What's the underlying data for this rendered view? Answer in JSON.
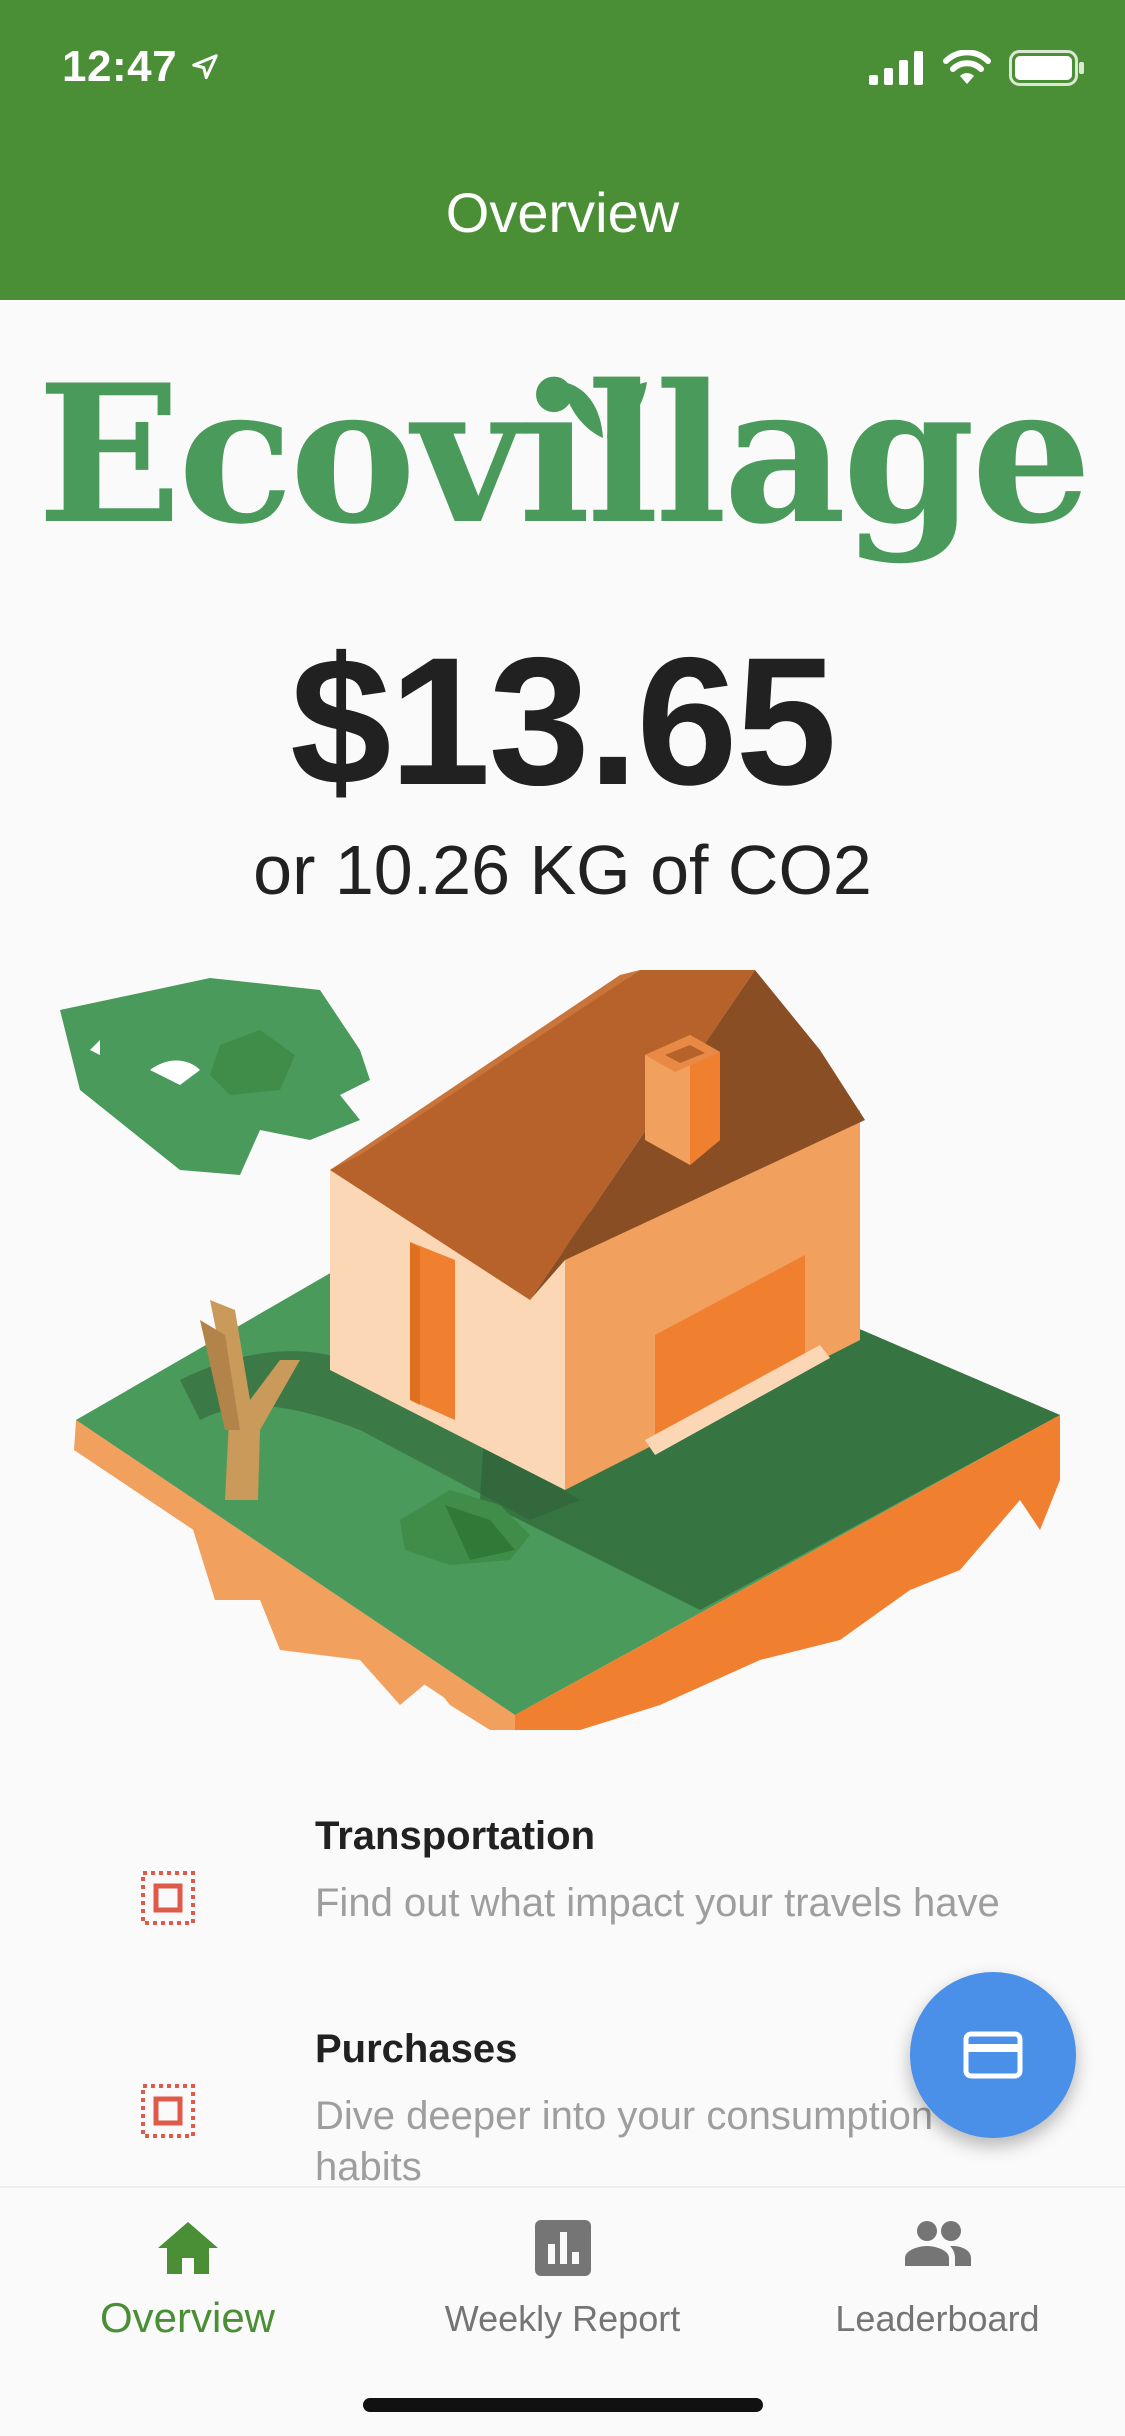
{
  "status_bar": {
    "time": "12:47",
    "icons": [
      "location-arrow-icon",
      "cellular-signal-icon",
      "wifi-icon",
      "battery-icon"
    ]
  },
  "app_bar": {
    "title": "Overview"
  },
  "logo": {
    "text": "Ecovillage",
    "color": "#4a9a5c"
  },
  "summary": {
    "amount": "$13.65",
    "co2": "or 10.26 KG of CO2"
  },
  "categories": [
    {
      "title": "Transportation",
      "description": "Find out what impact your travels have",
      "icon": "category-placeholder-icon"
    },
    {
      "title": "Purchases",
      "description": "Dive deeper into your consumption habits",
      "icon": "category-placeholder-icon"
    }
  ],
  "fab": {
    "icon": "credit-card-icon",
    "color": "#4a8fe8"
  },
  "bottom_nav": {
    "items": [
      {
        "label": "Overview",
        "icon": "home-icon",
        "active": true
      },
      {
        "label": "Weekly Report",
        "icon": "bar-chart-icon",
        "active": false
      },
      {
        "label": "Leaderboard",
        "icon": "people-icon",
        "active": false
      }
    ]
  },
  "colors": {
    "app_bar": "#4a8e36",
    "active_nav": "#4a8e36",
    "inactive_nav": "#757575",
    "icon_accent": "#e05a4a"
  }
}
